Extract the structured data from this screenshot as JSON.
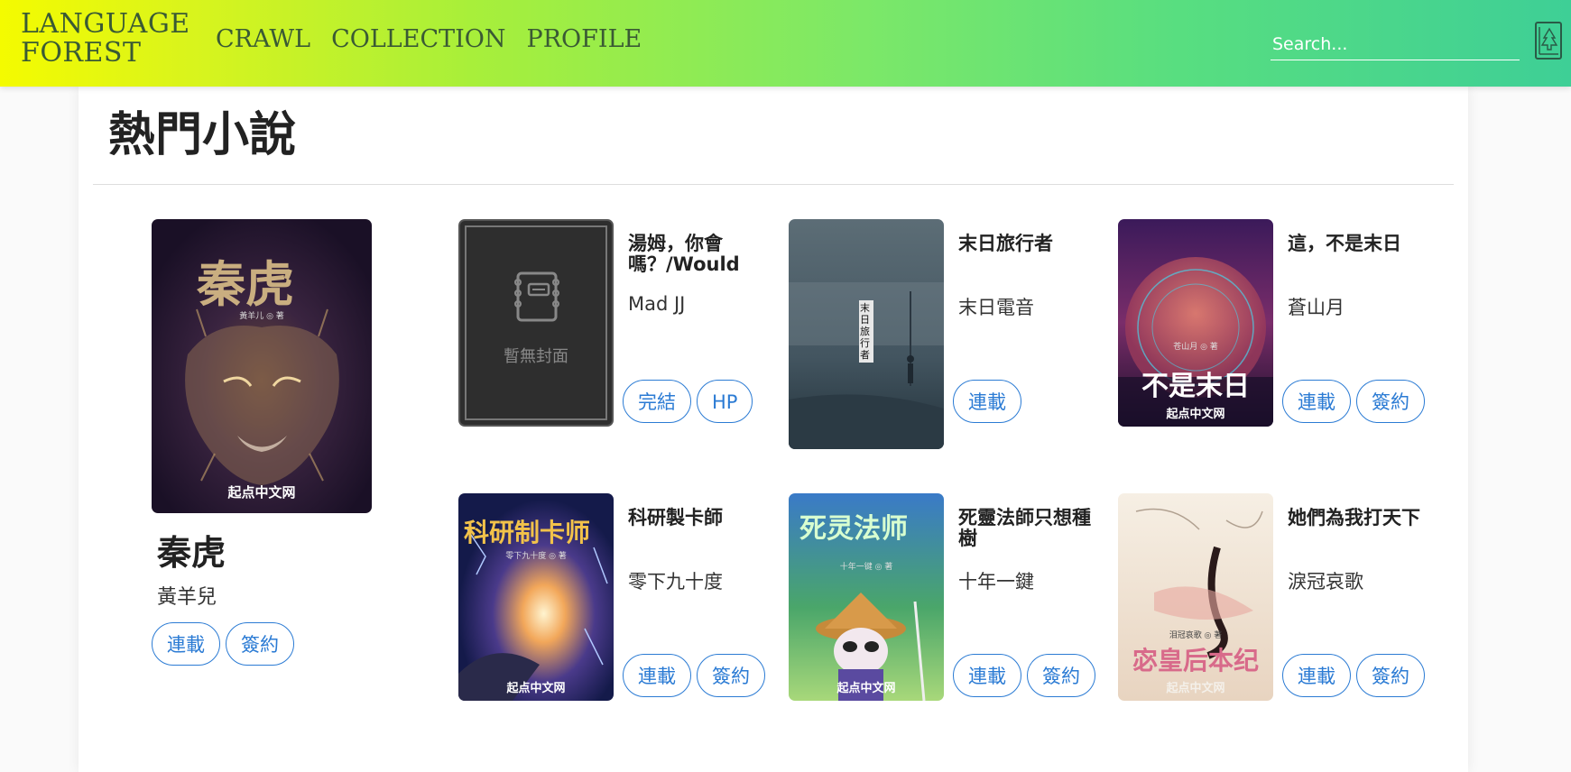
{
  "header": {
    "logo": "LANGUAGE FOREST",
    "nav": [
      "CRAWL",
      "COLLECTION",
      "PROFILE"
    ],
    "search_placeholder": "Search..."
  },
  "page_title": "熱門小說",
  "featured": {
    "cover_title": "秦虎",
    "cover_sub": "黃羊儿 ◎ 著",
    "cover_brand": "起点中文网",
    "title": "秦虎",
    "author": "黃羊兒",
    "tags": [
      "連載",
      "簽約"
    ]
  },
  "books": [
    {
      "title": "湯姆，你會嗎？/Would",
      "author": "Mad JJ",
      "tags": [
        "完結",
        "HP"
      ],
      "cover_text": "暫無封面",
      "cover_brand": "",
      "cover_sub": ""
    },
    {
      "title": "末日旅行者",
      "author": "末日電音",
      "tags": [
        "連載"
      ],
      "cover_text": "末日旅行者",
      "cover_brand": "",
      "cover_sub": ""
    },
    {
      "title": "這，不是末日",
      "author": "蒼山月",
      "tags": [
        "連載",
        "簽約"
      ],
      "cover_text": "不是末日",
      "cover_brand": "起点中文网",
      "cover_sub": "苍山月 ◎ 著"
    },
    {
      "title": "科研製卡師",
      "author": "零下九十度",
      "tags": [
        "連載",
        "簽約"
      ],
      "cover_text": "科研制卡师",
      "cover_brand": "起点中文网",
      "cover_sub": "零下九十度 ◎ 著"
    },
    {
      "title": "死靈法師只想種樹",
      "author": "十年一鍵",
      "tags": [
        "連載",
        "簽約"
      ],
      "cover_text": "死灵法师",
      "cover_brand": "起点中文网",
      "cover_sub": "十年一键 ◎ 著"
    },
    {
      "title": "她們為我打天下",
      "author": "淚冠哀歌",
      "tags": [
        "連載",
        "簽約"
      ],
      "cover_text": "宓皇后本纪",
      "cover_brand": "起点中文网",
      "cover_sub": "泪冠哀歌 ◎ 著"
    }
  ]
}
